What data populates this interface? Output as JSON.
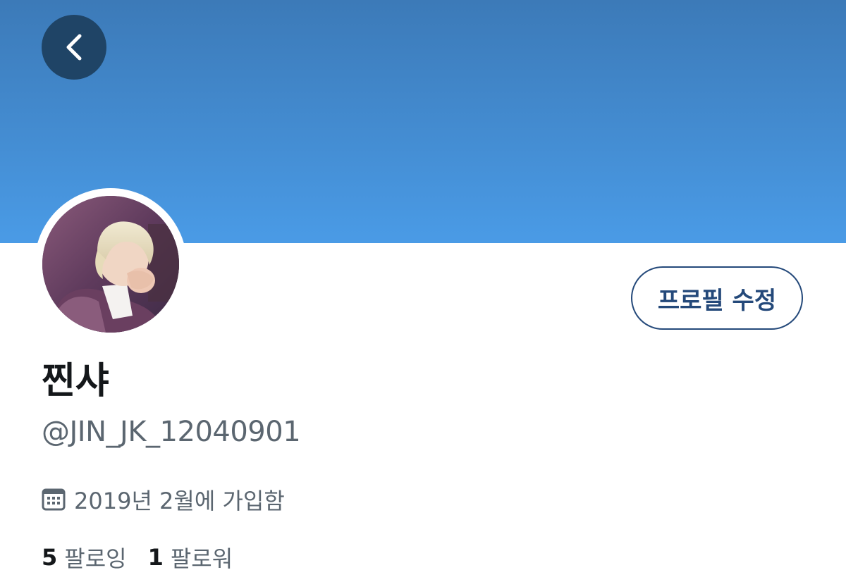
{
  "profile": {
    "display_name": "찐샤",
    "handle": "@JIN_JK_12040901",
    "joined": "2019년 2월에 가입함",
    "edit_label": "프로필 수정"
  },
  "stats": {
    "following_count": "5",
    "following_label": "팔로잉",
    "followers_count": "1",
    "followers_label": "팔로워"
  },
  "icons": {
    "back": "chevron-left-icon",
    "calendar": "calendar-icon"
  },
  "colors": {
    "banner_top": "#3c7ab8",
    "banner_bottom": "#4a9be6",
    "accent": "#24497a",
    "back_button_bg": "#1f4466",
    "secondary_text": "#5b6670",
    "primary_text": "#14171a"
  }
}
